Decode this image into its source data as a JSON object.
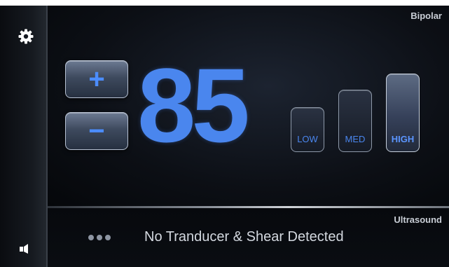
{
  "icons": {
    "settings": "gear-icon",
    "sound": "speaker-icon"
  },
  "bipolar": {
    "mode_label": "Bipolar",
    "power_value": "85",
    "increase_label": "+",
    "decrease_label": "−",
    "levels": [
      {
        "label": "LOW",
        "active": false
      },
      {
        "label": "MED",
        "active": false
      },
      {
        "label": "HIGH",
        "active": true
      }
    ]
  },
  "ultrasound": {
    "mode_label": "Ultrasound",
    "status_text": "No Tranducer & Shear Detected"
  },
  "colors": {
    "accent": "#4a86ee",
    "background": "#000000"
  }
}
